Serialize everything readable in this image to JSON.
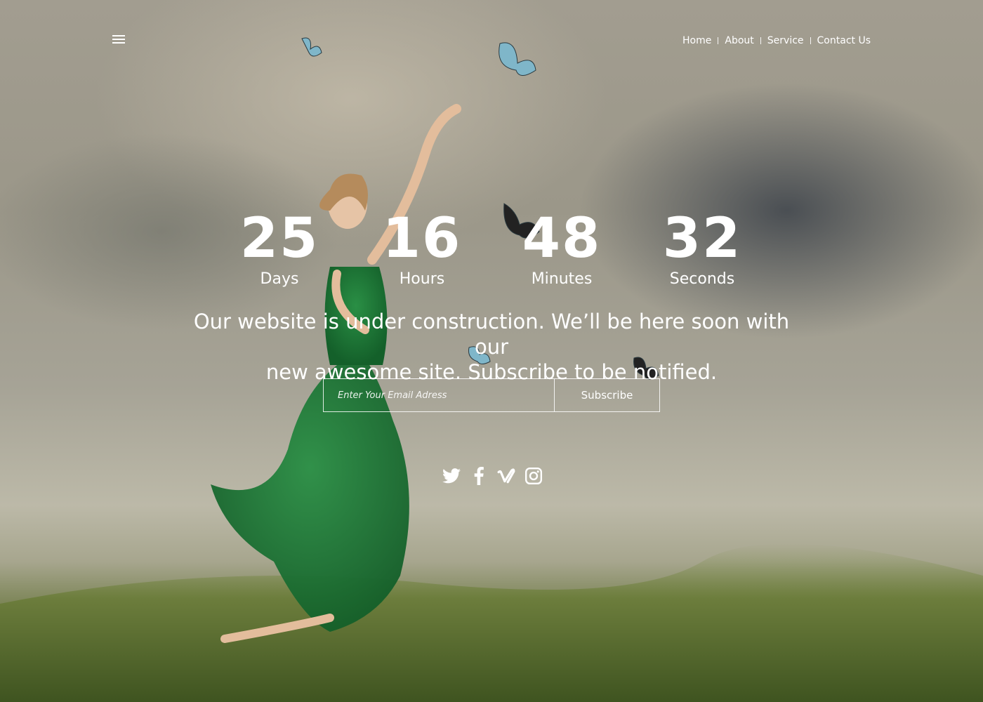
{
  "nav": {
    "items": [
      {
        "label": "Home"
      },
      {
        "label": "About"
      },
      {
        "label": "Service"
      },
      {
        "label": "Contact Us"
      }
    ]
  },
  "countdown": {
    "days": {
      "value": "25",
      "label": "Days"
    },
    "hours": {
      "value": "16",
      "label": "Hours"
    },
    "minutes": {
      "value": "48",
      "label": "Minutes"
    },
    "seconds": {
      "value": "32",
      "label": "Seconds"
    }
  },
  "message": {
    "line1": "Our website is under construction. We’ll be here soon with our",
    "line2": "new awesome site. Subscribe to be notified."
  },
  "subscribe": {
    "placeholder": "Enter Your Email Adress",
    "button_label": "Subscribe"
  },
  "social": {
    "icons": [
      "twitter-icon",
      "facebook-icon",
      "vimeo-icon",
      "instagram-icon"
    ]
  },
  "colors": {
    "dress": "#1f7a3a",
    "grass": "#55672e",
    "text": "#ffffff"
  }
}
